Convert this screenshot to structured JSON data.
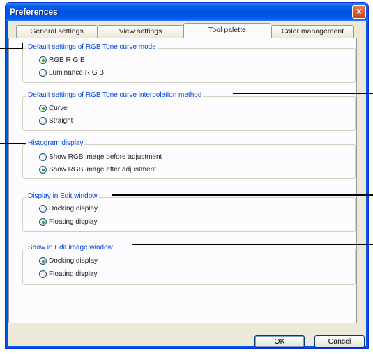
{
  "window": {
    "title": "Preferences"
  },
  "tabs": [
    {
      "label": "General settings",
      "active": false
    },
    {
      "label": "View settings",
      "active": false
    },
    {
      "label": "Tool palette",
      "active": true
    },
    {
      "label": "Color management",
      "active": false
    }
  ],
  "groups": [
    {
      "title": "Default settings of RGB Tone curve mode",
      "options": [
        {
          "label": "RGB R G B",
          "checked": true
        },
        {
          "label": "Luminance R G B",
          "checked": false
        }
      ]
    },
    {
      "title": "Default settings of RGB Tone curve interpolation method",
      "options": [
        {
          "label": "Curve",
          "checked": true
        },
        {
          "label": "Straight",
          "checked": false
        }
      ]
    },
    {
      "title": "Histogram display",
      "options": [
        {
          "label": "Show RGB image before adjustment",
          "checked": false
        },
        {
          "label": "Show RGB image after adjustment",
          "checked": true
        }
      ]
    },
    {
      "title": "Display in Edit window",
      "options": [
        {
          "label": "Docking display",
          "checked": false
        },
        {
          "label": "Floating display",
          "checked": true
        }
      ]
    },
    {
      "title": "Show in Edit image window",
      "options": [
        {
          "label": "Docking display",
          "checked": true
        },
        {
          "label": "Floating display",
          "checked": false
        }
      ]
    }
  ],
  "buttons": {
    "ok": "OK",
    "cancel": "Cancel"
  },
  "colors": {
    "title_bar": "#0054e3",
    "group_title": "#0046d5",
    "active_tab_accent": "#e68b2c",
    "radio_dot": "#21a121"
  }
}
